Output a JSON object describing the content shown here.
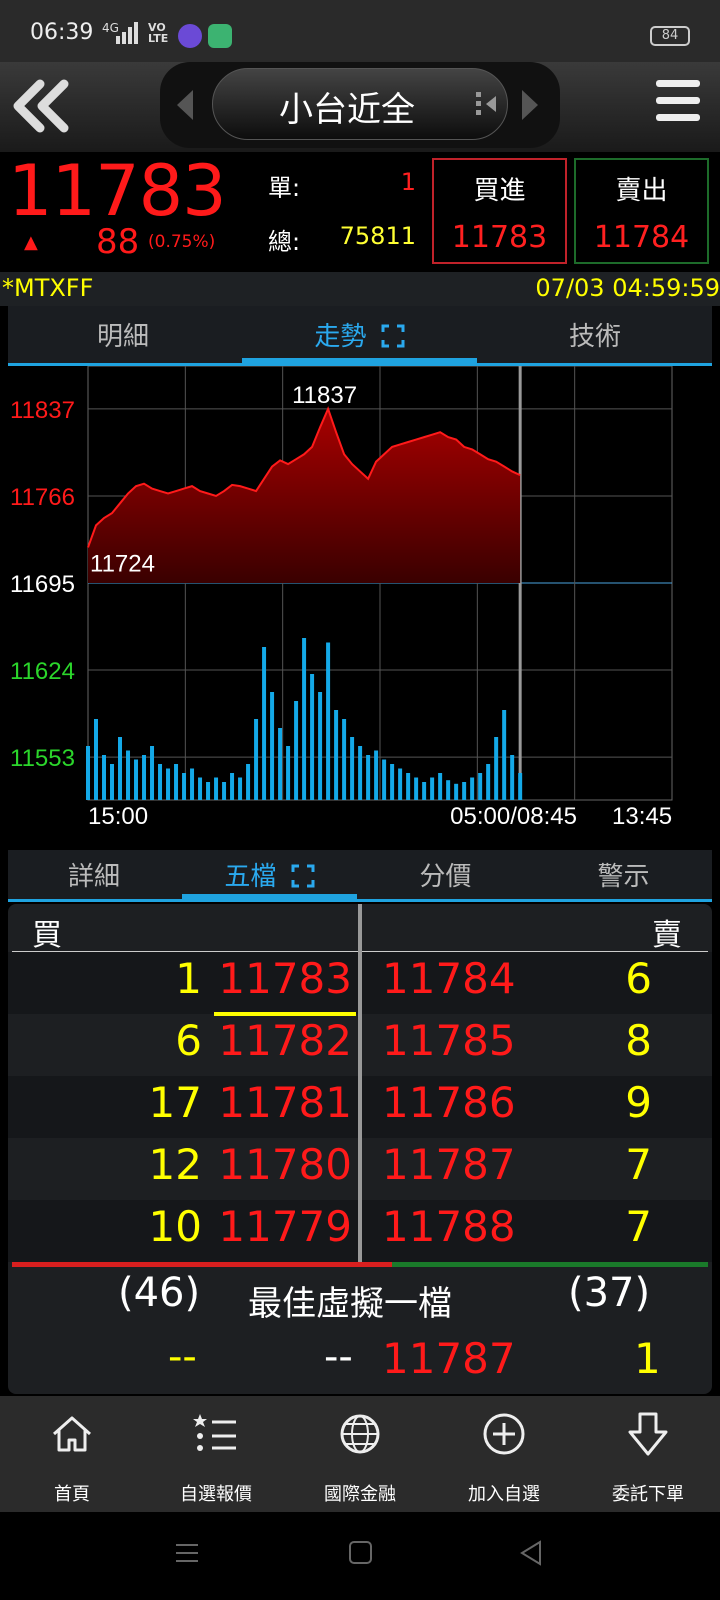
{
  "status_bar": {
    "time": "06:39",
    "network": "4G",
    "volte": "VO LTE",
    "battery": "84"
  },
  "header": {
    "title": "小台近全",
    "back_icon": "double-chevron-left-icon",
    "menu_icon": "hamburger-menu-icon"
  },
  "quote": {
    "last_price": "11783",
    "change_arrow": "▲",
    "change": "88",
    "change_pct": "(0.75%)",
    "unit_label": "單:",
    "unit_value": "1",
    "total_label": "總:",
    "total_value": "75811",
    "buy_label": "買進",
    "buy_price": "11783",
    "sell_label": "賣出",
    "sell_price": "11784"
  },
  "info": {
    "ticker": "*MTXFF",
    "datetime": "07/03 04:59:59"
  },
  "tabs_top": [
    {
      "label": "明細"
    },
    {
      "label": "走勢"
    },
    {
      "label": "技術"
    }
  ],
  "chart_data": {
    "type": "area",
    "y_ticks": [
      "11837",
      "11766",
      "11695",
      "11624",
      "11553"
    ],
    "x_ticks": [
      "15:00",
      "05:00/08:45",
      "13:45"
    ],
    "high_label": "11837",
    "low_label": "11724",
    "ylim": [
      11518,
      11872
    ],
    "colors": {
      "up": "#ff1a1a",
      "ref": "#ffffff",
      "down": "#2bd62b",
      "volume": "#14a9e8",
      "area": "#8a0000"
    },
    "price": [
      11724,
      11742,
      11748,
      11752,
      11760,
      11768,
      11774,
      11776,
      11772,
      11770,
      11768,
      11770,
      11772,
      11774,
      11770,
      11768,
      11766,
      11770,
      11775,
      11774,
      11772,
      11770,
      11780,
      11790,
      11795,
      11792,
      11796,
      11800,
      11806,
      11822,
      11837,
      11818,
      11800,
      11792,
      11786,
      11780,
      11794,
      11800,
      11806,
      11808,
      11810,
      11812,
      11814,
      11816,
      11818,
      11814,
      11812,
      11806,
      11804,
      11800,
      11796,
      11794,
      11790,
      11786,
      11783
    ],
    "volume": [
      60,
      90,
      50,
      40,
      70,
      55,
      45,
      50,
      60,
      40,
      35,
      40,
      30,
      35,
      25,
      20,
      25,
      20,
      30,
      25,
      40,
      90,
      170,
      120,
      80,
      60,
      110,
      180,
      140,
      120,
      175,
      100,
      90,
      70,
      60,
      50,
      55,
      45,
      40,
      35,
      30,
      25,
      20,
      25,
      30,
      22,
      18,
      20,
      25,
      30,
      40,
      70,
      100,
      50,
      30
    ]
  },
  "tabs_bottom": [
    {
      "label": "詳細"
    },
    {
      "label": "五檔"
    },
    {
      "label": "分價"
    },
    {
      "label": "警示"
    }
  ],
  "order_book": {
    "buy_header": "買",
    "sell_header": "賣",
    "rows": [
      {
        "bid_qty": "1",
        "bid": "11783",
        "ask": "11784",
        "ask_qty": "6"
      },
      {
        "bid_qty": "6",
        "bid": "11782",
        "ask": "11785",
        "ask_qty": "8"
      },
      {
        "bid_qty": "17",
        "bid": "11781",
        "ask": "11786",
        "ask_qty": "9"
      },
      {
        "bid_qty": "12",
        "bid": "11780",
        "ask": "11787",
        "ask_qty": "7"
      },
      {
        "bid_qty": "10",
        "bid": "11779",
        "ask": "11788",
        "ask_qty": "7"
      }
    ],
    "total_buy": "(46)",
    "total_sell": "(37)",
    "virtual_label": "最佳虛擬一檔",
    "virtual_bid_qty": "--",
    "virtual_bid": "--",
    "virtual_ask": "11787",
    "virtual_ask_qty": "1"
  },
  "bottom_nav": [
    {
      "label": "首頁",
      "icon": "home-icon"
    },
    {
      "label": "自選報價",
      "icon": "star-list-icon"
    },
    {
      "label": "國際金融",
      "icon": "globe-icon"
    },
    {
      "label": "加入自選",
      "icon": "add-circle-icon"
    },
    {
      "label": "委託下單",
      "icon": "download-arrow-icon"
    }
  ]
}
